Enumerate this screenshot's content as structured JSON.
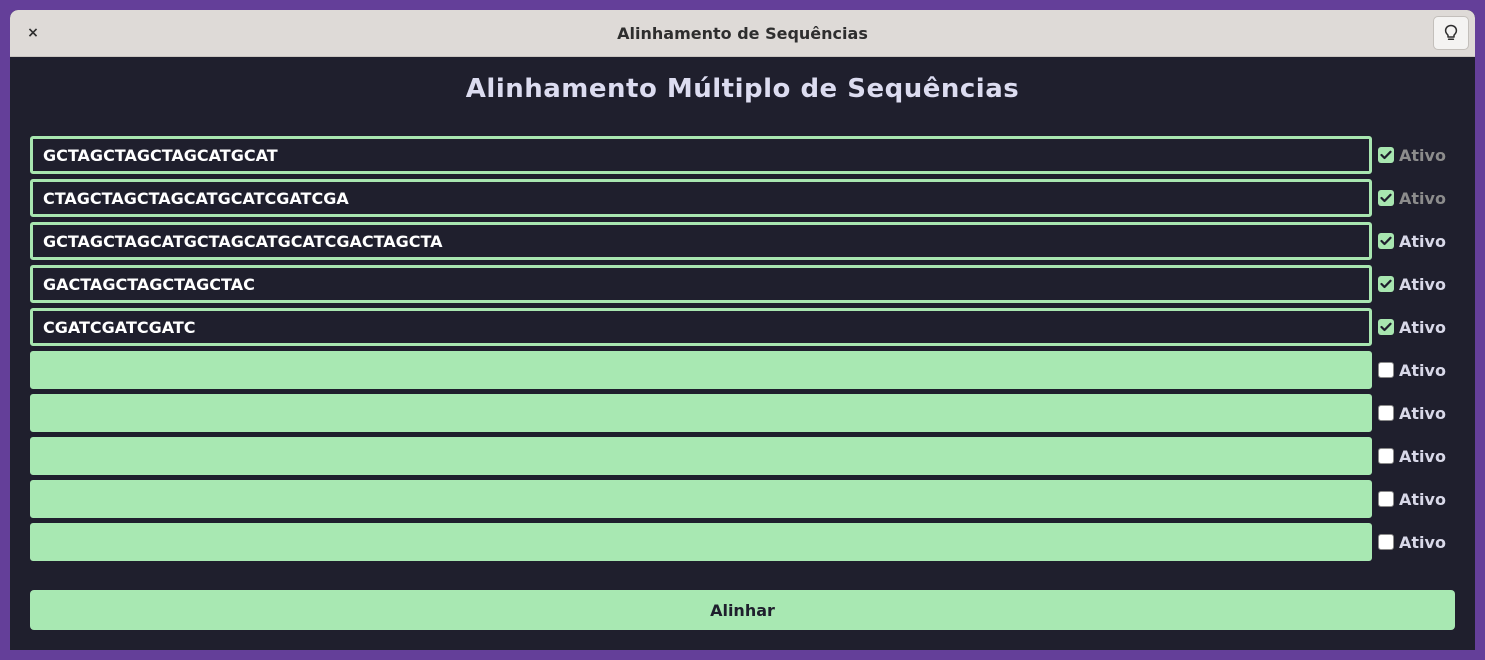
{
  "window": {
    "title": "Alinhamento de Sequências"
  },
  "titlebar": {
    "close_label": "×",
    "theme_icon": "lightbulb-icon"
  },
  "heading": "Alinhamento Múltiplo de Sequências",
  "sequences": [
    {
      "value": "GCTAGCTAGCTAGCATGCAT",
      "checked": true,
      "label": "Ativo"
    },
    {
      "value": "CTAGCTAGCTAGCATGCATCGATCGA",
      "checked": true,
      "label": "Ativo"
    },
    {
      "value": "GCTAGCTAGCATGCTAGCATGCATCGACTAGCTA",
      "checked": true,
      "label": "Ativo"
    },
    {
      "value": "GACTAGCTAGCTAGCTAC",
      "checked": true,
      "label": "Ativo"
    },
    {
      "value": "CGATCGATCGATC",
      "checked": true,
      "label": "Ativo"
    },
    {
      "value": "",
      "checked": false,
      "label": "Ativo"
    },
    {
      "value": "",
      "checked": false,
      "label": "Ativo"
    },
    {
      "value": "",
      "checked": false,
      "label": "Ativo"
    },
    {
      "value": "",
      "checked": false,
      "label": "Ativo"
    },
    {
      "value": "",
      "checked": false,
      "label": "Ativo"
    }
  ],
  "align_button": "Alinhar",
  "colors": {
    "accent": "#a8e6b0",
    "background": "#1f1f2d",
    "desktop": "#643f99"
  }
}
